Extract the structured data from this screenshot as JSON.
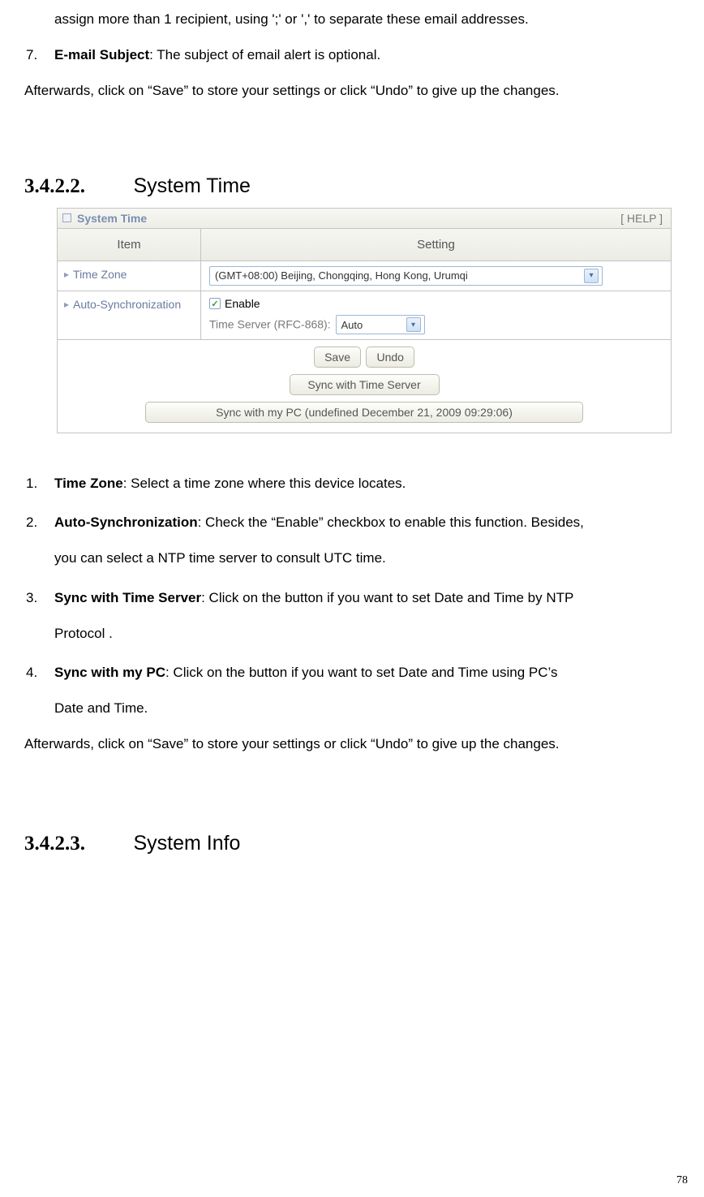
{
  "intro": {
    "line_cont": "assign more than 1 recipient, using ';' or ',' to separate these email addresses.",
    "item7_num": "7.",
    "item7_bold": "E-mail Subject",
    "item7_rest": ": The subject of email alert is optional.",
    "afterwards": "Afterwards, click on “Save” to store your settings or click “Undo” to give up the changes."
  },
  "section2": {
    "num": "3.4.2.2.",
    "title": "System Time"
  },
  "fig": {
    "panel_title": "System Time",
    "help": "[ HELP ]",
    "hdr_item": "Item",
    "hdr_setting": "Setting",
    "row_timezone": "Time Zone",
    "tz_value": "(GMT+08:00) Beijing, Chongqing, Hong Kong, Urumqi",
    "row_autosync": "Auto-Synchronization",
    "enable": "Enable",
    "ts_label": "Time Server (RFC-868):",
    "ts_value": "Auto",
    "btn_save": "Save",
    "btn_undo": "Undo",
    "btn_sync_server": "Sync with Time Server",
    "btn_sync_pc": "Sync with my PC (undefined December 21, 2009 09:29:06)"
  },
  "list": {
    "n1": "1.",
    "b1": "Time Zone",
    "r1": ": Select a time zone where this device locates.",
    "n2": "2.",
    "b2": "Auto-Synchronization",
    "r2a": ": Check the “Enable” checkbox to enable this function. Besides,",
    "r2b": "you can select a NTP time server to consult UTC time.",
    "n3": "3.",
    "b3": "Sync with Time Server",
    "r3a": ": Click on the button if you want to set Date and Time by NTP",
    "r3b": "Protocol .",
    "n4": "4.",
    "b4": "Sync with my PC",
    "r4a": ": Click on the button if you want to set Date and Time using PC’s",
    "r4b": "Date and Time.",
    "afterwards": "Afterwards, click on “Save” to store your settings or click “Undo” to give up the changes."
  },
  "section3": {
    "num": "3.4.2.3.",
    "title": "System Info"
  },
  "pagenum": "78"
}
